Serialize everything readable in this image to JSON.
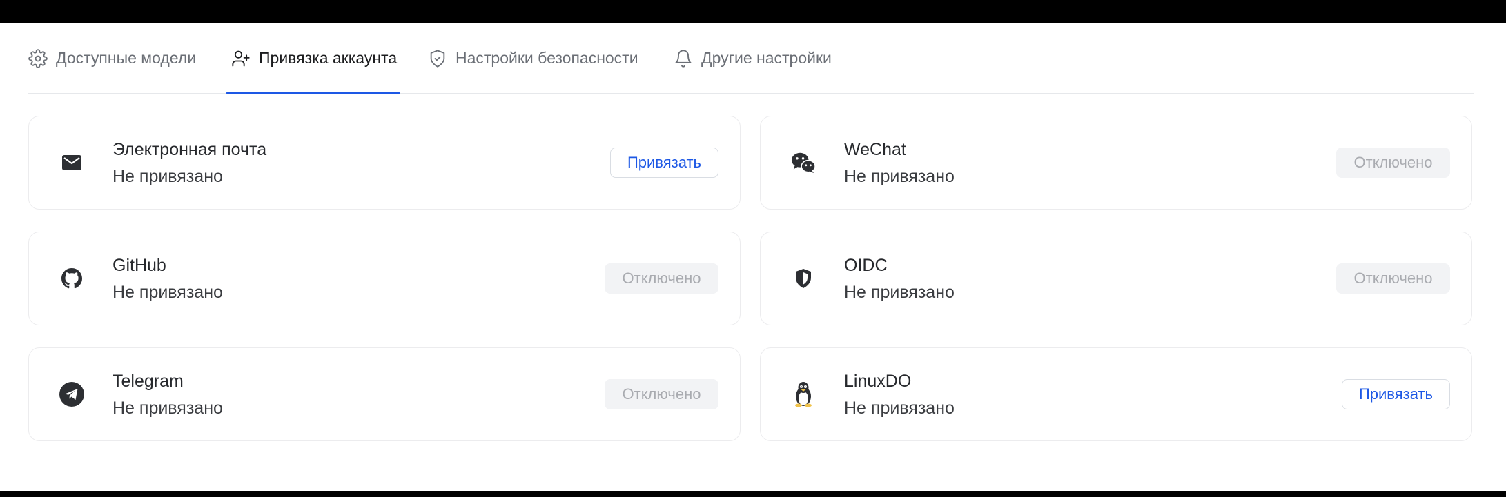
{
  "tabs": [
    {
      "label": "Доступные модели",
      "icon": "gear-icon",
      "active": false
    },
    {
      "label": "Привязка аккаунта",
      "icon": "user-plus-icon",
      "active": true
    },
    {
      "label": "Настройки безопасности",
      "icon": "shield-check-icon",
      "active": false
    },
    {
      "label": "Другие настройки",
      "icon": "bell-icon",
      "active": false
    }
  ],
  "accent_color": "#1d58e5",
  "accounts": [
    {
      "name": "Электронная почта",
      "status": "Не привязано",
      "icon": "mail-icon",
      "action": "Привязать",
      "enabled": true
    },
    {
      "name": "WeChat",
      "status": "Не привязано",
      "icon": "wechat-icon",
      "action": "Отключено",
      "enabled": false
    },
    {
      "name": "GitHub",
      "status": "Не привязано",
      "icon": "github-icon",
      "action": "Отключено",
      "enabled": false
    },
    {
      "name": "OIDC",
      "status": "Не привязано",
      "icon": "shield-icon",
      "action": "Отключено",
      "enabled": false
    },
    {
      "name": "Telegram",
      "status": "Не привязано",
      "icon": "telegram-icon",
      "action": "Отключено",
      "enabled": false
    },
    {
      "name": "LinuxDO",
      "status": "Не привязано",
      "icon": "linux-penguin-icon",
      "action": "Привязать",
      "enabled": true
    }
  ]
}
